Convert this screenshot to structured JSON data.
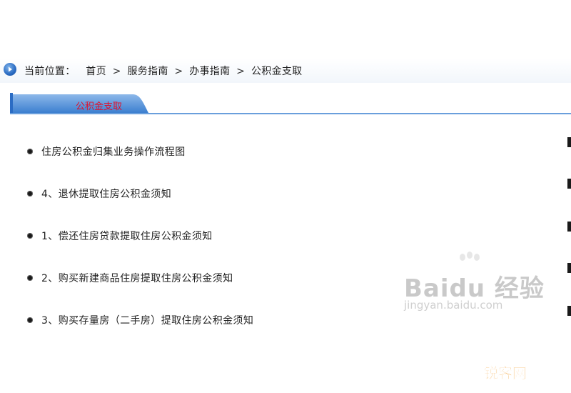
{
  "breadcrumb": {
    "label": "当前位置：",
    "separator": ">",
    "items": [
      "首页",
      "服务指南",
      "办事指南",
      "公积金支取"
    ]
  },
  "section_tab": {
    "label": "公积金支取"
  },
  "list": {
    "items": [
      "住房公积金归集业务操作流程图",
      "4、退休提取住房公积金须知",
      "1、偿还住房贷款提取住房公积金须知",
      "2、购买新建商品住房提取住房公积金须知",
      "3、购买存量房（二手房）提取住房公积金须知"
    ]
  },
  "watermarks": {
    "baidu": "Baidu 经验",
    "baidu_url": "jingyan.baidu.com",
    "site": "锐客网"
  },
  "colors": {
    "accent_blue": "#2b6cc4",
    "tab_text": "#e0102a",
    "site_watermark": "#f08a00"
  },
  "icons": {
    "breadcrumb": "location-arrow-icon",
    "bullet": "bullet-dot-icon"
  }
}
